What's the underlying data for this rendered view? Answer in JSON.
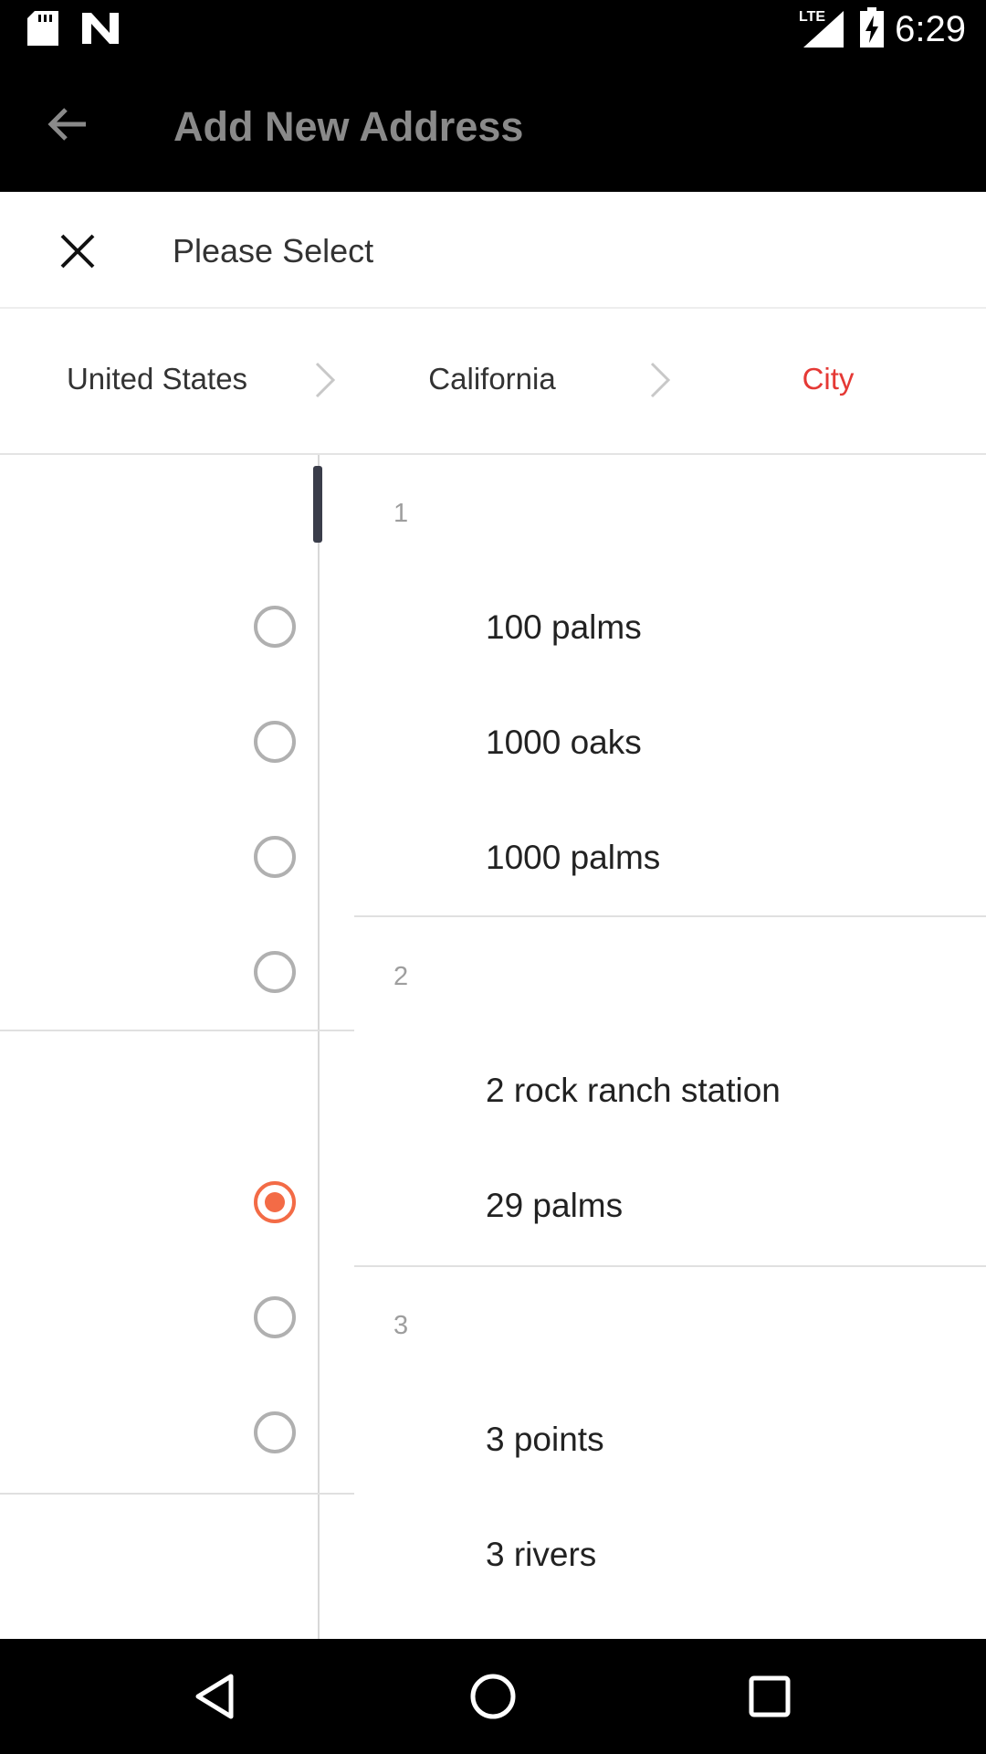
{
  "status_bar": {
    "time": "6:29",
    "icons": [
      "sd-card-icon",
      "n-notification-icon",
      "lte-signal-icon",
      "battery-charging-icon"
    ],
    "network_label": "LTE"
  },
  "app_bar": {
    "title": "Add New Address",
    "back_icon": "arrow-back-icon"
  },
  "sheet": {
    "title": "Please Select",
    "close_icon": "close-icon"
  },
  "breadcrumb": {
    "items": [
      {
        "label": "United States"
      },
      {
        "label": "California"
      },
      {
        "label": "City"
      }
    ],
    "active_color": "#e53935"
  },
  "city_list": {
    "groups": [
      {
        "letter": "1",
        "cities": [
          "100 palms",
          "1000 oaks",
          "1000 palms"
        ]
      },
      {
        "letter": "2",
        "cities": [
          "2 rock ranch station",
          "29 palms"
        ]
      },
      {
        "letter": "3",
        "cities": [
          "3 points",
          "3 rivers"
        ]
      }
    ],
    "selected_radio_index": 5,
    "accent_color": "#f36b46"
  },
  "nav_bar": {
    "icons": [
      "back-triangle-icon",
      "home-circle-icon",
      "recents-square-icon"
    ]
  }
}
